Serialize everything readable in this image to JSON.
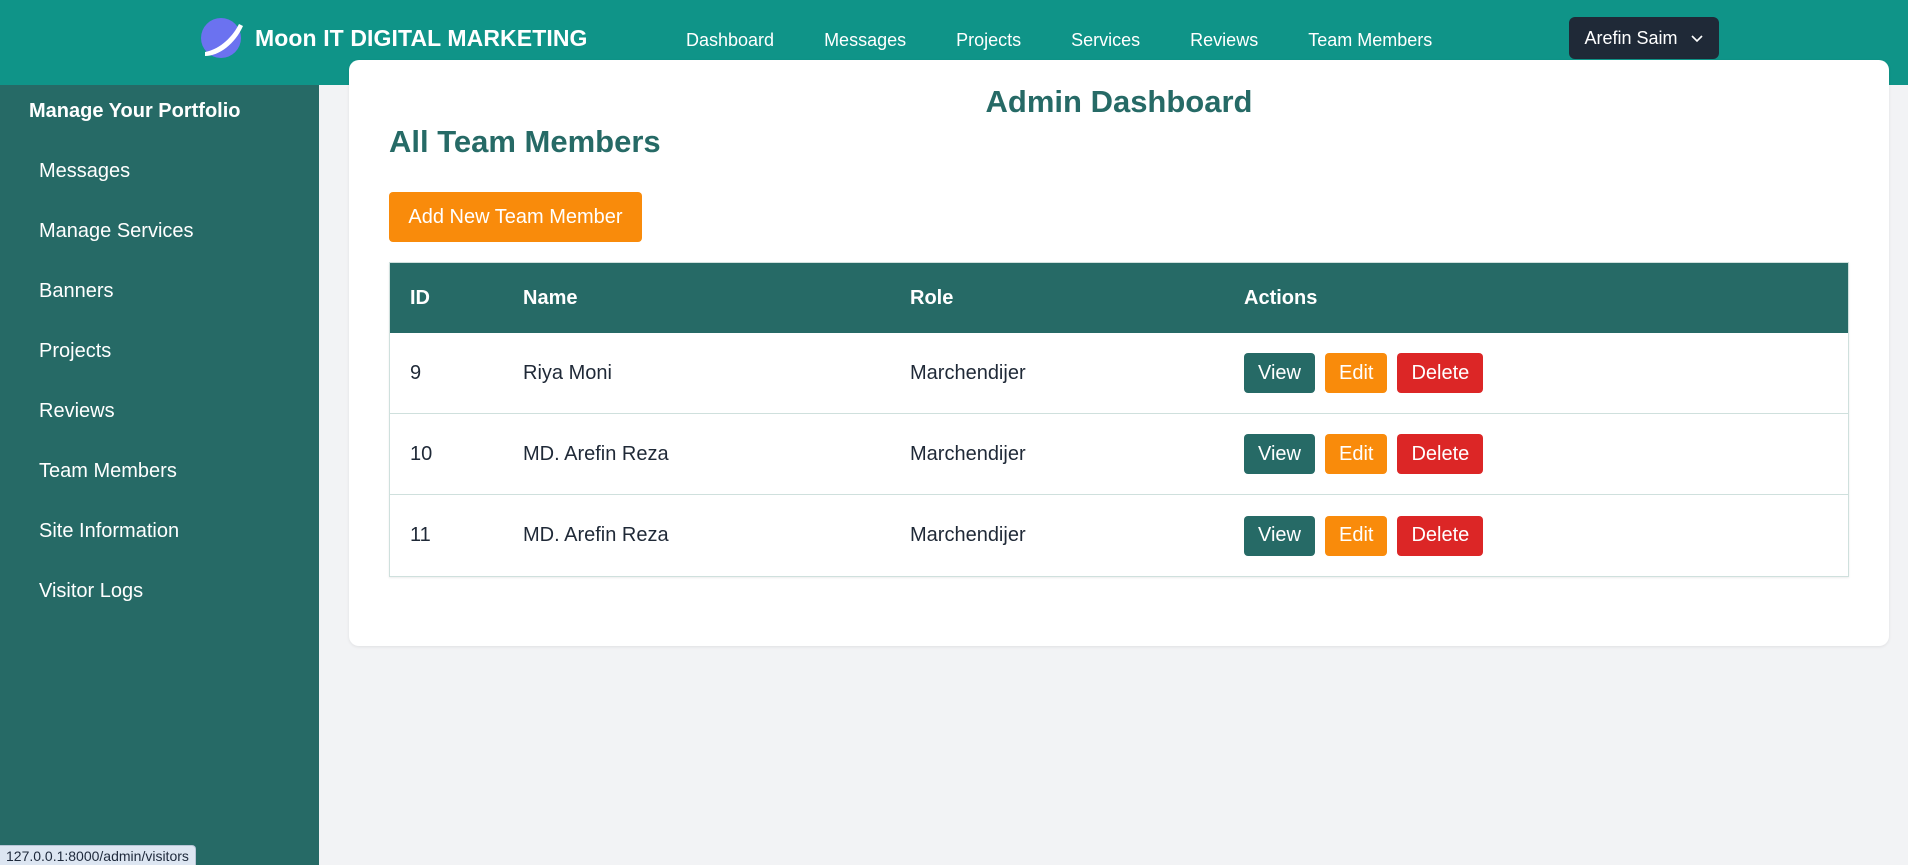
{
  "brand": {
    "name": "Moon IT DIGITAL MARKETING",
    "logo_icon": "moon-logo-icon"
  },
  "nav": {
    "items": [
      "Dashboard",
      "Messages",
      "Projects",
      "Services",
      "Reviews",
      "Team Members"
    ]
  },
  "user": {
    "name": "Arefin Saim"
  },
  "sidebar": {
    "title": "Manage Your Portfolio",
    "items": [
      "Messages",
      "Manage Services",
      "Banners",
      "Projects",
      "Reviews",
      "Team Members",
      "Site Information",
      "Visitor Logs"
    ]
  },
  "main": {
    "admin_title": "Admin Dashboard",
    "section_title": "All Team Members",
    "add_button": "Add New Team Member",
    "table": {
      "headers": [
        "ID",
        "Name",
        "Role",
        "Actions"
      ],
      "rows": [
        {
          "id": "9",
          "name": "Riya Moni",
          "role": "Marchendijer"
        },
        {
          "id": "10",
          "name": "MD. Arefin Reza",
          "role": "Marchendijer"
        },
        {
          "id": "11",
          "name": "MD. Arefin Reza",
          "role": "Marchendijer"
        }
      ],
      "actions": {
        "view": "View",
        "edit": "Edit",
        "delete": "Delete"
      }
    }
  },
  "status_url": "127.0.0.1:8000/admin/visitors",
  "colors": {
    "header": "#0f9488",
    "sidebar": "#266a66",
    "accent": "#f98b0b",
    "danger": "#dc2626"
  }
}
